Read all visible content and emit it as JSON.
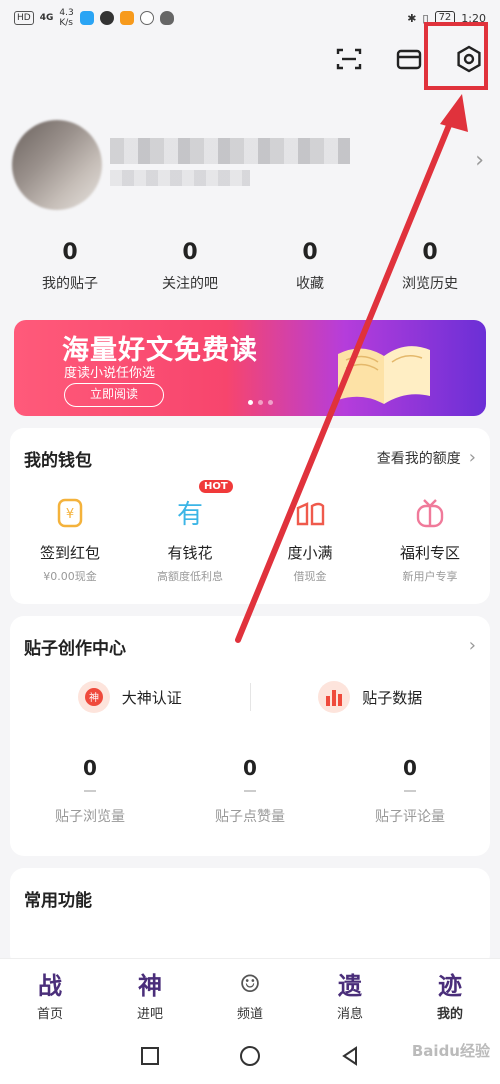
{
  "status_bar": {
    "hd_badge": "HD",
    "signal": "4G",
    "speed_value": "4.3",
    "speed_unit": "K/s",
    "battery": "72",
    "time": "1:20"
  },
  "stats": [
    {
      "count": "0",
      "label": "我的贴子"
    },
    {
      "count": "0",
      "label": "关注的吧"
    },
    {
      "count": "0",
      "label": "收藏"
    },
    {
      "count": "0",
      "label": "浏览历史"
    }
  ],
  "banner": {
    "title": "海量好文免费读",
    "subtitle": "度读小说任你选",
    "button": "立即阅读"
  },
  "wallet": {
    "title": "我的钱包",
    "link": "查看我的额度",
    "items": [
      {
        "label": "签到红包",
        "sub": "¥0.00现金",
        "icon": "yen-coin-icon"
      },
      {
        "label": "有钱花",
        "sub": "高额度低利息",
        "icon": "you-qian-hua-icon",
        "badge": "HOT"
      },
      {
        "label": "度小满",
        "sub": "借现金",
        "icon": "du-xiao-man-icon"
      },
      {
        "label": "福利专区",
        "sub": "新用户专享",
        "icon": "gift-icon"
      }
    ]
  },
  "creation": {
    "title": "贴子创作中心",
    "actions": [
      {
        "label": "大神认证",
        "icon": "god-badge-icon"
      },
      {
        "label": "贴子数据",
        "icon": "bar-chart-icon"
      }
    ],
    "stats": [
      {
        "count": "0",
        "label": "贴子浏览量"
      },
      {
        "count": "0",
        "label": "贴子点赞量"
      },
      {
        "count": "0",
        "label": "贴子评论量"
      }
    ]
  },
  "common": {
    "title": "常用功能"
  },
  "bottom_nav": [
    {
      "label": "首页",
      "glyph": "战"
    },
    {
      "label": "进吧",
      "glyph": "神"
    },
    {
      "label": "频道",
      "glyph": "☺"
    },
    {
      "label": "消息",
      "glyph": "遗"
    },
    {
      "label": "我的",
      "glyph": "迹"
    }
  ],
  "watermark": "Baidu经验",
  "colors": {
    "accent": "#e0323c",
    "banner_pink": "#f7456d",
    "banner_purple": "#6b2fd6",
    "hot_red": "#f03a3a"
  }
}
